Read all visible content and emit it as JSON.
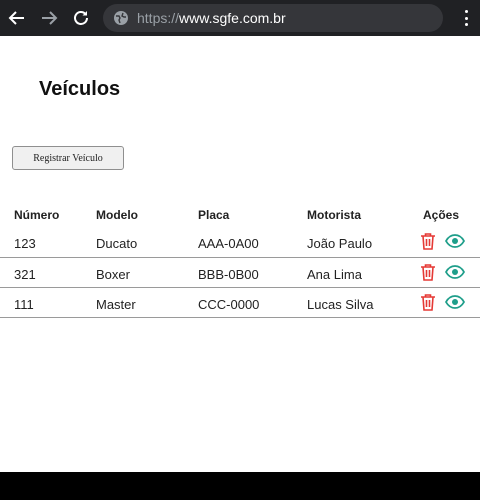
{
  "browser": {
    "url_scheme": "https://",
    "url_host": "www.sgfe.com.br"
  },
  "page": {
    "title": "Veículos",
    "register_button_label": "Registrar Veículo"
  },
  "table": {
    "columns": [
      "Número",
      "Modelo",
      "Placa",
      "Motorista",
      "Ações"
    ],
    "rows": [
      {
        "numero": "123",
        "modelo": "Ducato",
        "placa": "AAA-0A00",
        "motorista": "João Paulo"
      },
      {
        "numero": "321",
        "modelo": "Boxer",
        "placa": "BBB-0B00",
        "motorista": "Ana Lima"
      },
      {
        "numero": "111",
        "modelo": "Master",
        "placa": "CCC-0000",
        "motorista": "Lucas Silva"
      }
    ]
  },
  "icons": {
    "delete": "trash-icon",
    "view": "eye-icon"
  },
  "colors": {
    "delete_icon": "#e53935",
    "view_icon": "#1e9e8a",
    "browser_chrome": "#202124",
    "omnibox": "#35363a"
  }
}
